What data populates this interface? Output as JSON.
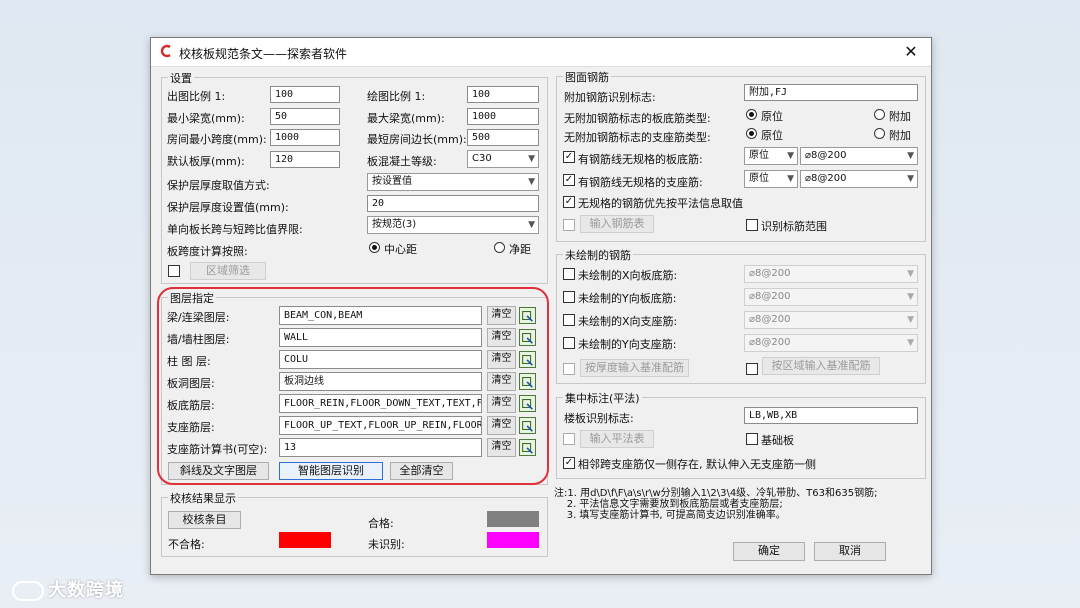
{
  "window": {
    "title": "校核板规范条文——探索者软件",
    "close": "✕"
  },
  "settings": {
    "title": "设置",
    "out_scale_label": "出图比例 1:",
    "out_scale": "100",
    "draw_scale_label": "绘图比例 1:",
    "draw_scale": "100",
    "min_beam_label": "最小梁宽(mm):",
    "min_beam": "50",
    "max_beam_label": "最大梁宽(mm):",
    "max_beam": "1000",
    "min_span_label": "房间最小跨度(mm):",
    "min_span": "1000",
    "min_edge_label": "最短房间边长(mm):",
    "min_edge": "500",
    "thick_label": "默认板厚(mm):",
    "thick": "120",
    "concrete_label": "板混凝土等级:",
    "concrete": "C30",
    "cover_method_label": "保护层厚度取值方式:",
    "cover_method": "按设置值",
    "cover_value_label": "保护层厚度设置值(mm):",
    "cover_value": "20",
    "ratio_label": "单向板长跨与短跨比值界限:",
    "ratio": "按规范(3)",
    "span_calc_label": "板跨度计算按照:",
    "span_center": "中心距",
    "span_net": "净距",
    "area_filter": "区域筛选"
  },
  "layers": {
    "title": "图层指定",
    "clear": "清空",
    "rows": [
      {
        "label": "梁/连梁图层:",
        "value": "BEAM_CON,BEAM"
      },
      {
        "label": "墙/墙柱图层:",
        "value": "WALL"
      },
      {
        "label": "柱 图 层:",
        "value": "COLU"
      },
      {
        "label": "板洞图层:",
        "value": "板洞边线"
      },
      {
        "label": "板底筋层:",
        "value": "FLOOR_REIN,FLOOR_DOWN_TEXT,TEXT,FL"
      },
      {
        "label": "支座筋层:",
        "value": "FLOOR_UP_TEXT,FLOOR_UP_REIN,FLOOR_"
      },
      {
        "label": "支座筋计算书(可空):",
        "value": "13"
      }
    ],
    "btn_diag": "斜线及文字图层",
    "btn_smart": "智能图层识别",
    "btn_clear_all": "全部清空"
  },
  "result": {
    "title": "校核结果显示",
    "btn_items": "校核条目",
    "pass": "合格:",
    "fail": "不合格:",
    "unknown": "未识别:",
    "pass_color": "#808080",
    "fail_color": "#ff0000",
    "unknown_color": "#ff00ff"
  },
  "surface": {
    "title": "图面钢筋",
    "extra_label": "附加钢筋识别标志:",
    "extra": "附加,FJ",
    "bottom_type_label": "无附加钢筋标志的板底筋类型:",
    "support_type_label": "无附加钢筋标志的支座筋类型:",
    "opt_orig": "原位",
    "opt_extra": "附加",
    "bottom_chk": "有钢筋线无规格的板底筋:",
    "bottom_pos": "原位",
    "bottom_spec": "⌀8@200",
    "support_chk": "有钢筋线无规格的支座筋:",
    "support_pos": "原位",
    "support_spec": "⌀8@200",
    "prefer_chk": "无规格的钢筋优先按平法信息取值",
    "input_table": "输入钢筋表",
    "recognize_range": "识别标筋范围"
  },
  "undrawn": {
    "title": "未绘制的钢筋",
    "rows": [
      {
        "label": "未绘制的X向板底筋:",
        "spec": "⌀8@200"
      },
      {
        "label": "未绘制的Y向板底筋:",
        "spec": "⌀8@200"
      },
      {
        "label": "未绘制的X向支座筋:",
        "spec": "⌀8@200"
      },
      {
        "label": "未绘制的Y向支座筋:",
        "spec": "⌀8@200"
      }
    ],
    "by_thick": "按厚度输入基准配筋",
    "by_area": "按区域输入基准配筋"
  },
  "concentrated": {
    "title": "集中标注(平法)",
    "mark_label": "楼板识别标志:",
    "mark": "LB,WB,XB",
    "input_table": "输入平法表",
    "base_plate": "基础板",
    "adjacent": "相邻跨支座筋仅一侧存在, 默认伸入无支座筋一侧"
  },
  "notes": [
    "注:1. 用d\\D\\f\\F\\a\\s\\r\\w分别输入1\\2\\3\\4级、冷轧带肋、T63和635钢筋;",
    "    2. 平法信息文字需要放到板底筋层或者支座筋层;",
    "    3. 填写支座筋计算书, 可提高简支边识别准确率。"
  ],
  "footer": {
    "ok": "确定",
    "cancel": "取消"
  },
  "watermark": "大数跨境"
}
